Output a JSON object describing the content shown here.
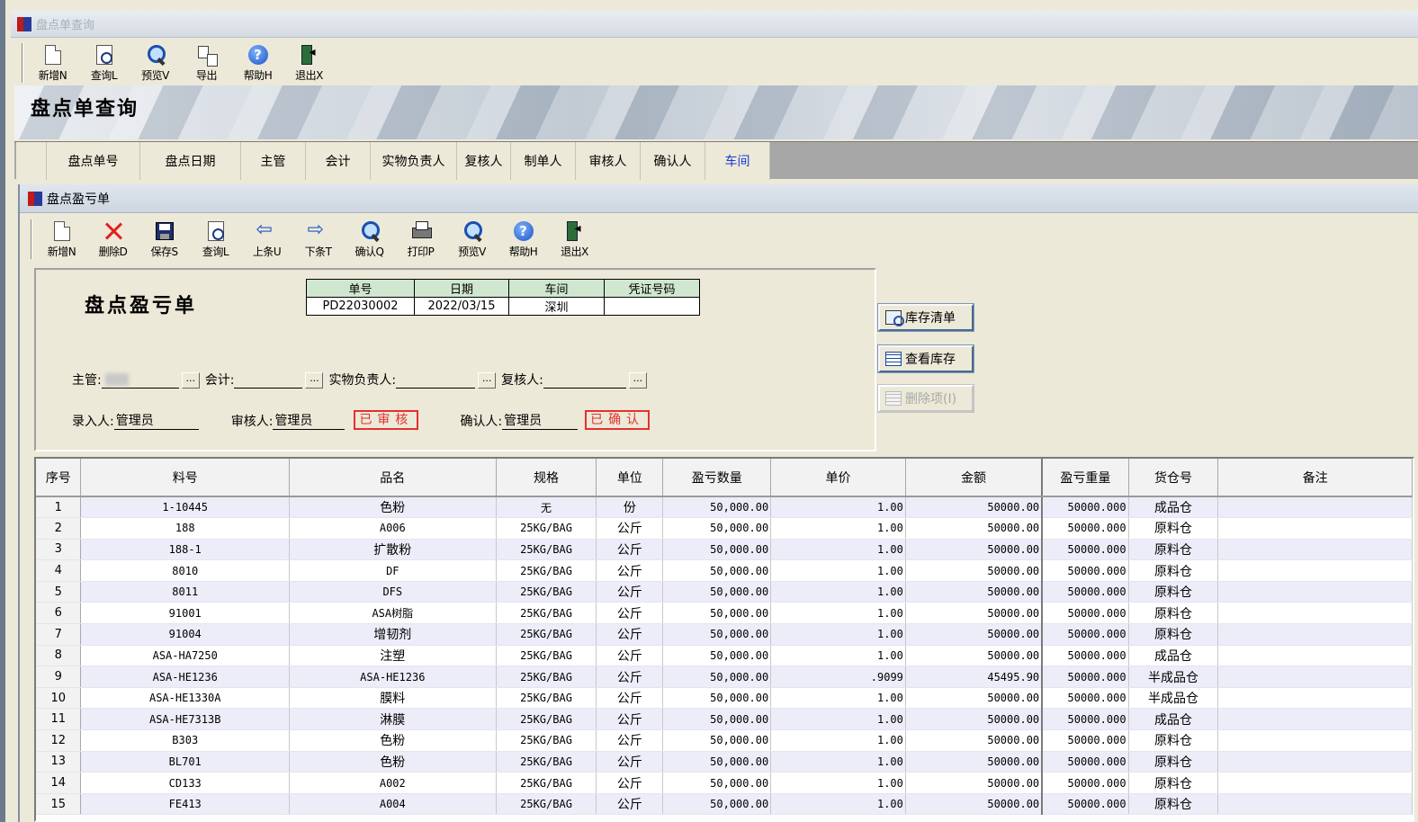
{
  "window": {
    "title": "盘点单查询"
  },
  "main_toolbar": [
    {
      "label": "新增N",
      "icon": "new-doc-icon"
    },
    {
      "label": "查询L",
      "icon": "query-icon"
    },
    {
      "label": "预览V",
      "icon": "preview-icon"
    },
    {
      "label": "导出",
      "icon": "export-icon"
    },
    {
      "label": "帮助H",
      "icon": "help-icon"
    },
    {
      "label": "退出X",
      "icon": "exit-icon"
    }
  ],
  "banner": {
    "title": "盘点单查询"
  },
  "column_tabs": [
    "",
    "盘点单号",
    "盘点日期",
    "主管",
    "会计",
    "实物负责人",
    "复核人",
    "制单人",
    "审核人",
    "确认人",
    "车间"
  ],
  "active_tab": "车间",
  "inner_window": {
    "title": "盘点盈亏单"
  },
  "inner_toolbar": [
    {
      "label": "新增N",
      "icon": "new-doc-icon"
    },
    {
      "label": "删除D",
      "icon": "delete-icon"
    },
    {
      "label": "保存S",
      "icon": "save-icon"
    },
    {
      "label": "查询L",
      "icon": "query-icon"
    },
    {
      "label": "上条U",
      "icon": "prev-arrow-icon"
    },
    {
      "label": "下条T",
      "icon": "next-arrow-icon"
    },
    {
      "label": "确认Q",
      "icon": "confirm-search-icon"
    },
    {
      "label": "打印P",
      "icon": "print-icon"
    },
    {
      "label": "预览V",
      "icon": "preview-icon"
    },
    {
      "label": "帮助H",
      "icon": "help-icon"
    },
    {
      "label": "退出X",
      "icon": "exit-icon"
    }
  ],
  "form": {
    "title": "盘点盈亏单",
    "header_cols": [
      "单号",
      "日期",
      "车间",
      "凭证号码"
    ],
    "header_vals": [
      "PD22030002",
      "2022/03/15",
      "深圳",
      ""
    ],
    "supervisor_label": "主管:",
    "supervisor_value": "",
    "accountant_label": "会计:",
    "accountant_value": "",
    "custodian_label": "实物负责人:",
    "custodian_value": "",
    "reviewer_label": "复核人:",
    "reviewer_value": "",
    "entry_label": "录入人:",
    "entry_value": "管理员",
    "auditor_label": "审核人:",
    "auditor_value": "管理员",
    "audited_stamp": "已审核",
    "confirmer_label": "确认人:",
    "confirmer_value": "管理员",
    "confirmed_stamp": "已确认",
    "lookup_btn": "..."
  },
  "side_buttons": {
    "inventory_list": "库存清单",
    "view_inventory": "查看库存",
    "delete_item": "删除项(I)"
  },
  "grid": {
    "columns": [
      "序号",
      "料号",
      "品名",
      "规格",
      "单位",
      "盈亏数量",
      "单价",
      "金额",
      "盈亏重量",
      "货仓号",
      "备注"
    ],
    "rows": [
      [
        "1",
        "1-10445",
        "色粉",
        "无",
        "份",
        "50,000.00",
        "1.00",
        "50000.00",
        "50000.000",
        "成品仓",
        ""
      ],
      [
        "2",
        "188",
        "A006",
        "25KG/BAG",
        "公斤",
        "50,000.00",
        "1.00",
        "50000.00",
        "50000.000",
        "原料仓",
        ""
      ],
      [
        "3",
        "188-1",
        "扩散粉",
        "25KG/BAG",
        "公斤",
        "50,000.00",
        "1.00",
        "50000.00",
        "50000.000",
        "原料仓",
        ""
      ],
      [
        "4",
        "8010",
        "DF",
        "25KG/BAG",
        "公斤",
        "50,000.00",
        "1.00",
        "50000.00",
        "50000.000",
        "原料仓",
        ""
      ],
      [
        "5",
        "8011",
        "DFS",
        "25KG/BAG",
        "公斤",
        "50,000.00",
        "1.00",
        "50000.00",
        "50000.000",
        "原料仓",
        ""
      ],
      [
        "6",
        "91001",
        "ASA树脂",
        "25KG/BAG",
        "公斤",
        "50,000.00",
        "1.00",
        "50000.00",
        "50000.000",
        "原料仓",
        ""
      ],
      [
        "7",
        "91004",
        "增韧剂",
        "25KG/BAG",
        "公斤",
        "50,000.00",
        "1.00",
        "50000.00",
        "50000.000",
        "原料仓",
        ""
      ],
      [
        "8",
        "ASA-HA7250",
        "注塑",
        "25KG/BAG",
        "公斤",
        "50,000.00",
        "1.00",
        "50000.00",
        "50000.000",
        "成品仓",
        ""
      ],
      [
        "9",
        "ASA-HE1236",
        "ASA-HE1236",
        "25KG/BAG",
        "公斤",
        "50,000.00",
        ".9099",
        "45495.90",
        "50000.000",
        "半成品仓",
        ""
      ],
      [
        "10",
        "ASA-HE1330A",
        "膜料",
        "25KG/BAG",
        "公斤",
        "50,000.00",
        "1.00",
        "50000.00",
        "50000.000",
        "半成品仓",
        ""
      ],
      [
        "11",
        "ASA-HE7313B",
        "淋膜",
        "25KG/BAG",
        "公斤",
        "50,000.00",
        "1.00",
        "50000.00",
        "50000.000",
        "成品仓",
        ""
      ],
      [
        "12",
        "B303",
        "色粉",
        "25KG/BAG",
        "公斤",
        "50,000.00",
        "1.00",
        "50000.00",
        "50000.000",
        "原料仓",
        ""
      ],
      [
        "13",
        "BL701",
        "色粉",
        "25KG/BAG",
        "公斤",
        "50,000.00",
        "1.00",
        "50000.00",
        "50000.000",
        "原料仓",
        ""
      ],
      [
        "14",
        "CD133",
        "A002",
        "25KG/BAG",
        "公斤",
        "50,000.00",
        "1.00",
        "50000.00",
        "50000.000",
        "原料仓",
        ""
      ],
      [
        "15",
        "FE413",
        "A004",
        "25KG/BAG",
        "公斤",
        "50,000.00",
        "1.00",
        "50000.00",
        "50000.000",
        "原料仓",
        ""
      ]
    ]
  }
}
